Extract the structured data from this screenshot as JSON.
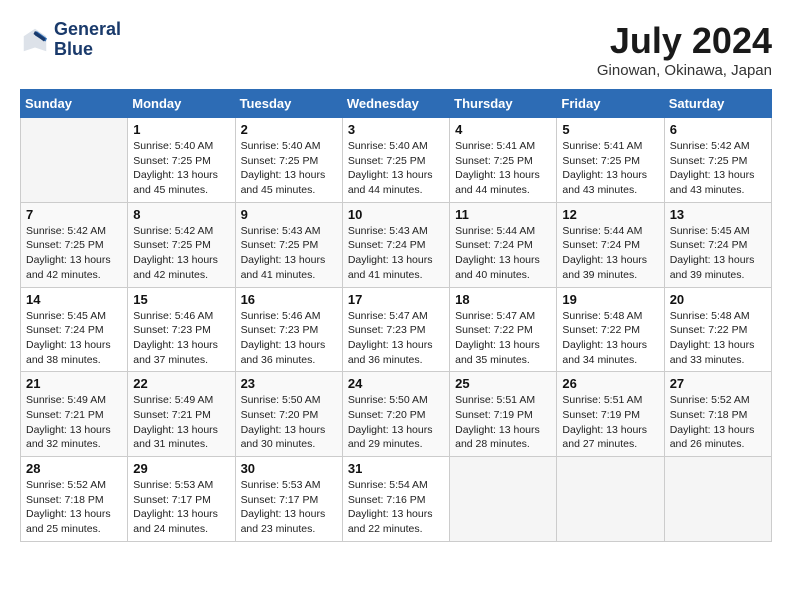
{
  "header": {
    "logo_line1": "General",
    "logo_line2": "Blue",
    "month_year": "July 2024",
    "location": "Ginowan, Okinawa, Japan"
  },
  "days_of_week": [
    "Sunday",
    "Monday",
    "Tuesday",
    "Wednesday",
    "Thursday",
    "Friday",
    "Saturday"
  ],
  "weeks": [
    [
      {
        "day": "",
        "sunrise": "",
        "sunset": "",
        "daylight": ""
      },
      {
        "day": "1",
        "sunrise": "5:40 AM",
        "sunset": "7:25 PM",
        "daylight": "13 hours and 45 minutes."
      },
      {
        "day": "2",
        "sunrise": "5:40 AM",
        "sunset": "7:25 PM",
        "daylight": "13 hours and 45 minutes."
      },
      {
        "day": "3",
        "sunrise": "5:40 AM",
        "sunset": "7:25 PM",
        "daylight": "13 hours and 44 minutes."
      },
      {
        "day": "4",
        "sunrise": "5:41 AM",
        "sunset": "7:25 PM",
        "daylight": "13 hours and 44 minutes."
      },
      {
        "day": "5",
        "sunrise": "5:41 AM",
        "sunset": "7:25 PM",
        "daylight": "13 hours and 43 minutes."
      },
      {
        "day": "6",
        "sunrise": "5:42 AM",
        "sunset": "7:25 PM",
        "daylight": "13 hours and 43 minutes."
      }
    ],
    [
      {
        "day": "7",
        "sunrise": "5:42 AM",
        "sunset": "7:25 PM",
        "daylight": "13 hours and 42 minutes."
      },
      {
        "day": "8",
        "sunrise": "5:42 AM",
        "sunset": "7:25 PM",
        "daylight": "13 hours and 42 minutes."
      },
      {
        "day": "9",
        "sunrise": "5:43 AM",
        "sunset": "7:25 PM",
        "daylight": "13 hours and 41 minutes."
      },
      {
        "day": "10",
        "sunrise": "5:43 AM",
        "sunset": "7:24 PM",
        "daylight": "13 hours and 41 minutes."
      },
      {
        "day": "11",
        "sunrise": "5:44 AM",
        "sunset": "7:24 PM",
        "daylight": "13 hours and 40 minutes."
      },
      {
        "day": "12",
        "sunrise": "5:44 AM",
        "sunset": "7:24 PM",
        "daylight": "13 hours and 39 minutes."
      },
      {
        "day": "13",
        "sunrise": "5:45 AM",
        "sunset": "7:24 PM",
        "daylight": "13 hours and 39 minutes."
      }
    ],
    [
      {
        "day": "14",
        "sunrise": "5:45 AM",
        "sunset": "7:24 PM",
        "daylight": "13 hours and 38 minutes."
      },
      {
        "day": "15",
        "sunrise": "5:46 AM",
        "sunset": "7:23 PM",
        "daylight": "13 hours and 37 minutes."
      },
      {
        "day": "16",
        "sunrise": "5:46 AM",
        "sunset": "7:23 PM",
        "daylight": "13 hours and 36 minutes."
      },
      {
        "day": "17",
        "sunrise": "5:47 AM",
        "sunset": "7:23 PM",
        "daylight": "13 hours and 36 minutes."
      },
      {
        "day": "18",
        "sunrise": "5:47 AM",
        "sunset": "7:22 PM",
        "daylight": "13 hours and 35 minutes."
      },
      {
        "day": "19",
        "sunrise": "5:48 AM",
        "sunset": "7:22 PM",
        "daylight": "13 hours and 34 minutes."
      },
      {
        "day": "20",
        "sunrise": "5:48 AM",
        "sunset": "7:22 PM",
        "daylight": "13 hours and 33 minutes."
      }
    ],
    [
      {
        "day": "21",
        "sunrise": "5:49 AM",
        "sunset": "7:21 PM",
        "daylight": "13 hours and 32 minutes."
      },
      {
        "day": "22",
        "sunrise": "5:49 AM",
        "sunset": "7:21 PM",
        "daylight": "13 hours and 31 minutes."
      },
      {
        "day": "23",
        "sunrise": "5:50 AM",
        "sunset": "7:20 PM",
        "daylight": "13 hours and 30 minutes."
      },
      {
        "day": "24",
        "sunrise": "5:50 AM",
        "sunset": "7:20 PM",
        "daylight": "13 hours and 29 minutes."
      },
      {
        "day": "25",
        "sunrise": "5:51 AM",
        "sunset": "7:19 PM",
        "daylight": "13 hours and 28 minutes."
      },
      {
        "day": "26",
        "sunrise": "5:51 AM",
        "sunset": "7:19 PM",
        "daylight": "13 hours and 27 minutes."
      },
      {
        "day": "27",
        "sunrise": "5:52 AM",
        "sunset": "7:18 PM",
        "daylight": "13 hours and 26 minutes."
      }
    ],
    [
      {
        "day": "28",
        "sunrise": "5:52 AM",
        "sunset": "7:18 PM",
        "daylight": "13 hours and 25 minutes."
      },
      {
        "day": "29",
        "sunrise": "5:53 AM",
        "sunset": "7:17 PM",
        "daylight": "13 hours and 24 minutes."
      },
      {
        "day": "30",
        "sunrise": "5:53 AM",
        "sunset": "7:17 PM",
        "daylight": "13 hours and 23 minutes."
      },
      {
        "day": "31",
        "sunrise": "5:54 AM",
        "sunset": "7:16 PM",
        "daylight": "13 hours and 22 minutes."
      },
      {
        "day": "",
        "sunrise": "",
        "sunset": "",
        "daylight": ""
      },
      {
        "day": "",
        "sunrise": "",
        "sunset": "",
        "daylight": ""
      },
      {
        "day": "",
        "sunrise": "",
        "sunset": "",
        "daylight": ""
      }
    ]
  ]
}
